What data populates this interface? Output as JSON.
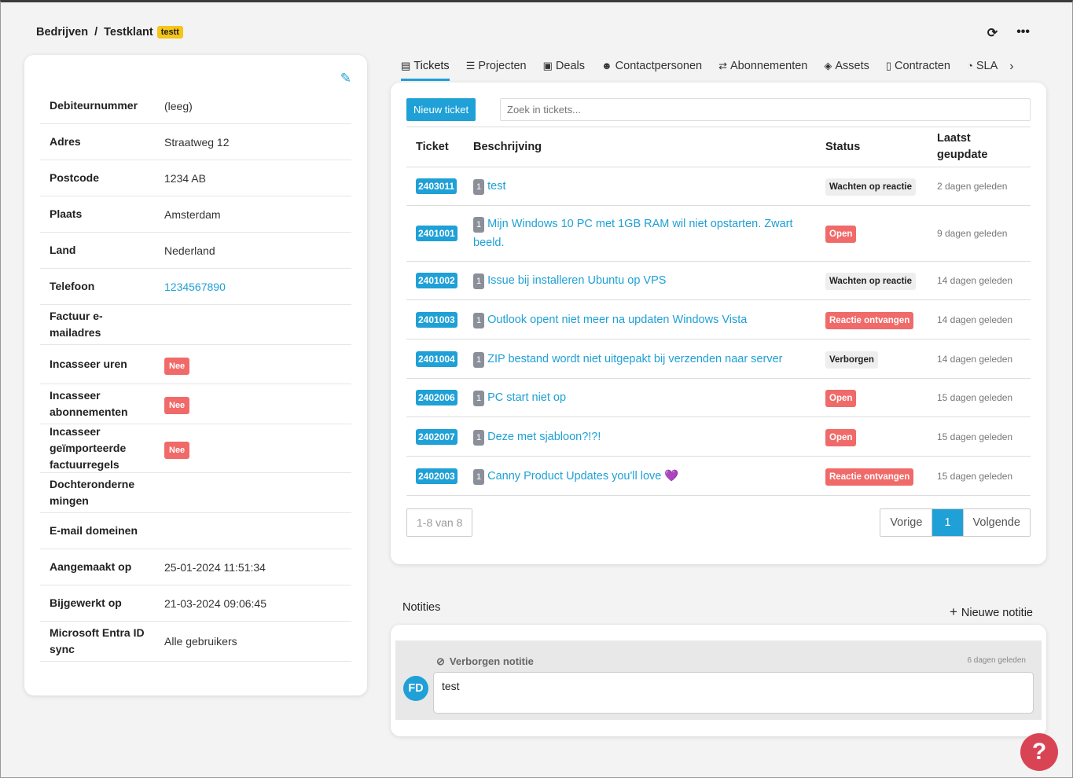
{
  "breadcrumb": {
    "parent": "Bedrijven",
    "separator": "/",
    "current": "Testklant",
    "tag": "testt"
  },
  "icons": {
    "refresh": "refresh-icon",
    "more": "more-icon",
    "edit": "edit-icon"
  },
  "company": {
    "fields": [
      {
        "label": "Debiteurnummer",
        "value": "(leeg)"
      },
      {
        "label": "Adres",
        "value": "Straatweg 12"
      },
      {
        "label": "Postcode",
        "value": "1234 AB"
      },
      {
        "label": "Plaats",
        "value": "Amsterdam"
      },
      {
        "label": "Land",
        "value": "Nederland"
      },
      {
        "label": "Telefoon",
        "value": "1234567890"
      },
      {
        "label": "Factuur e-mailadres",
        "value": ""
      },
      {
        "label": "Incasseer uren",
        "value": "Nee"
      },
      {
        "label": "Incasseer abonnementen",
        "value": "Nee"
      },
      {
        "label": "Incasseer geïmporteerde factuurregels",
        "value": "Nee"
      },
      {
        "label": "Dochterondernemingen",
        "value": ""
      },
      {
        "label": "E-mail domeinen",
        "value": ""
      },
      {
        "label": "Aangemaakt op",
        "value": "25-01-2024 11:51:34"
      },
      {
        "label": "Bijgewerkt op",
        "value": "21-03-2024 09:06:45"
      },
      {
        "label": "Microsoft Entra ID sync",
        "value": "Alle gebruikers"
      }
    ]
  },
  "tabs": [
    "Tickets",
    "Projecten",
    "Deals",
    "Contactpersonen",
    "Abonnementen",
    "Assets",
    "Contracten",
    "SLA"
  ],
  "tickets": {
    "new_button": "Nieuw ticket",
    "search_placeholder": "Zoek in tickets...",
    "columns": [
      "Ticket",
      "Beschrijving",
      "Status",
      "Laatst geupdate"
    ],
    "rows": [
      {
        "id": "2403011",
        "count": "1",
        "desc": "test",
        "status": "Wachten op reactie",
        "updated": "2 dagen geleden"
      },
      {
        "id": "2401001",
        "count": "1",
        "desc": "Mijn Windows 10 PC met 1GB RAM wil niet opstarten. Zwart beeld.",
        "status": "Open",
        "updated": "9 dagen geleden"
      },
      {
        "id": "2401002",
        "count": "1",
        "desc": "Issue bij installeren Ubuntu op VPS",
        "status": "Wachten op reactie",
        "updated": "14 dagen geleden"
      },
      {
        "id": "2401003",
        "count": "1",
        "desc": "Outlook opent niet meer na updaten Windows Vista",
        "status": "Reactie ontvangen",
        "updated": "14 dagen geleden"
      },
      {
        "id": "2401004",
        "count": "1",
        "desc": "ZIP bestand wordt niet uitgepakt bij verzenden naar server",
        "status": "Verborgen",
        "updated": "14 dagen geleden"
      },
      {
        "id": "2402006",
        "count": "1",
        "desc": "PC start niet op",
        "status": "Open",
        "updated": "15 dagen geleden"
      },
      {
        "id": "2402007",
        "count": "1",
        "desc": "Deze met sjabloon?!?!",
        "status": "Open",
        "updated": "15 dagen geleden"
      },
      {
        "id": "2402003",
        "count": "1",
        "desc": "Canny Product Updates you'll love 💜",
        "status": "Reactie ontvangen",
        "updated": "15 dagen geleden"
      }
    ],
    "pager_info": "1-8 van 8",
    "pager": {
      "prev": "Vorige",
      "current": "1",
      "next": "Volgende"
    }
  },
  "notes": {
    "title": "Notities",
    "new_label": "Nieuwe notitie",
    "items": [
      {
        "hidden_label": "Verborgen notitie",
        "ago": "6 dagen geleden",
        "initials": "FD",
        "body": "test"
      }
    ]
  },
  "help": "?"
}
